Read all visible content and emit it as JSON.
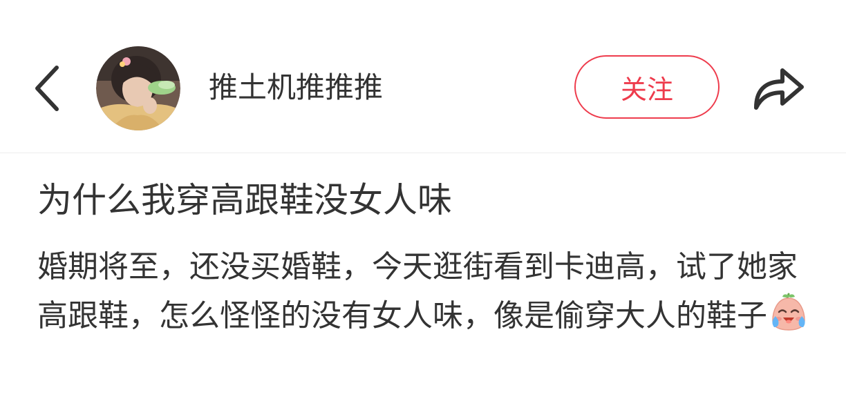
{
  "header": {
    "back_icon": "chevron-left-icon",
    "avatar_icon": "user-avatar",
    "username": "推土机推推推",
    "follow_label": "关注",
    "share_icon": "share-arrow-icon",
    "accent_color": "#ee3b4c"
  },
  "post": {
    "title": "为什么我穿高跟鞋没女人味",
    "body": "婚期将至，还没买婚鞋，今天逛街看到卡迪高，试了她家高跟鞋，怎么怪怪的没有女人味，像是偷穿大人的鞋子",
    "emoji_icon": "crying-laughing-emoji-icon"
  }
}
